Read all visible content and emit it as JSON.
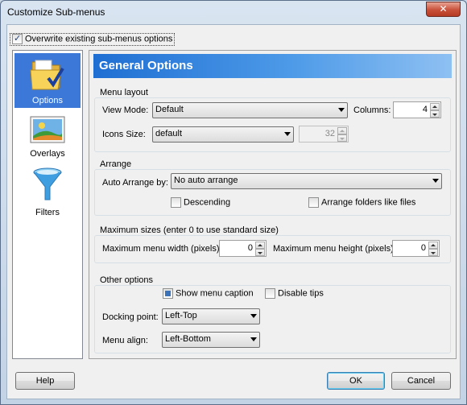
{
  "window": {
    "title": "Customize Sub-menus",
    "close_glyph": "✕"
  },
  "overwrite": {
    "label": "Overwrite existing sub-menus options",
    "checked": true
  },
  "sidebar": {
    "items": [
      {
        "label": "Options",
        "icon": "folder-checkmark-icon",
        "selected": true
      },
      {
        "label": "Overlays",
        "icon": "landscape-picture-icon",
        "selected": false
      },
      {
        "label": "Filters",
        "icon": "funnel-icon",
        "selected": false
      }
    ]
  },
  "panel": {
    "title": "General Options"
  },
  "menu_layout": {
    "group_label": "Menu layout",
    "view_mode_label": "View Mode:",
    "view_mode_value": "Default",
    "columns_label": "Columns:",
    "columns_value": "4",
    "icons_size_label": "Icons Size:",
    "icons_size_value": "default",
    "icons_size_number": "32"
  },
  "arrange": {
    "group_label": "Arrange",
    "auto_arrange_label": "Auto Arrange by:",
    "auto_arrange_value": "No auto arrange",
    "descending_label": "Descending",
    "descending_checked": false,
    "arrange_folders_label": "Arrange folders like files",
    "arrange_folders_checked": false
  },
  "max_sizes": {
    "group_label": "Maximum sizes (enter 0 to use standard size)",
    "width_label": "Maximum menu width (pixels):",
    "width_value": "0",
    "height_label": "Maximum menu height (pixels):",
    "height_value": "0"
  },
  "other": {
    "group_label": "Other options",
    "show_caption_label": "Show menu caption",
    "show_caption_checked": true,
    "disable_tips_label": "Disable tips",
    "disable_tips_checked": false,
    "docking_label": "Docking point:",
    "docking_value": "Left-Top",
    "align_label": "Menu align:",
    "align_value": "Left-Bottom"
  },
  "buttons": {
    "help": "Help",
    "ok": "OK",
    "cancel": "Cancel"
  },
  "colors": {
    "accent": "#3b78d8",
    "banner": "#1f6fd3",
    "close": "#c8503a"
  }
}
